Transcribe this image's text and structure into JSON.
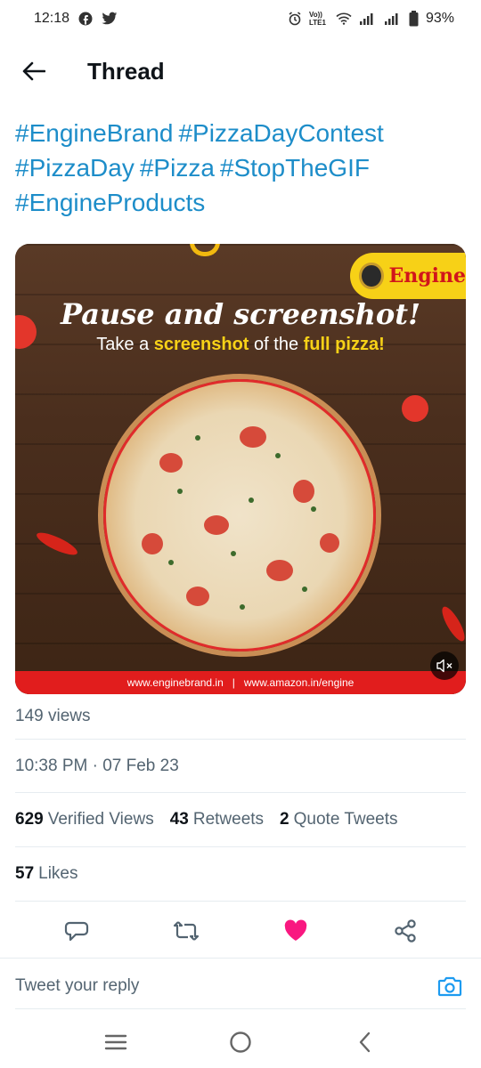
{
  "status_bar": {
    "time": "12:18",
    "battery": "93%",
    "network_label": "Vo)) LTE1"
  },
  "header": {
    "title": "Thread"
  },
  "tweet": {
    "hashtags": [
      "#EngineBrand",
      "#PizzaDayContest",
      "#PizzaDay",
      "#Pizza",
      "#StopTheGIF",
      "#EngineProducts"
    ],
    "media": {
      "brand": "Engine",
      "headline": "Pause and screenshot!",
      "subline_parts": [
        "Take a ",
        "screenshot",
        " of the ",
        "full pizza!"
      ],
      "footer_links": [
        "www.enginebrand.in",
        "|",
        "www.amazon.in/engine"
      ]
    },
    "views": "149 views",
    "timestamp": "10:38 PM · 07 Feb 23",
    "stats": [
      {
        "count": "629",
        "label": "Verified Views"
      },
      {
        "count": "43",
        "label": "Retweets"
      },
      {
        "count": "2",
        "label": "Quote Tweets"
      }
    ],
    "likes": {
      "count": "57",
      "label": "Likes"
    }
  },
  "reply": {
    "placeholder": "Tweet your reply"
  },
  "colors": {
    "link": "#1d8dc9",
    "like_active": "#f91880",
    "icon_gray": "#536471"
  }
}
